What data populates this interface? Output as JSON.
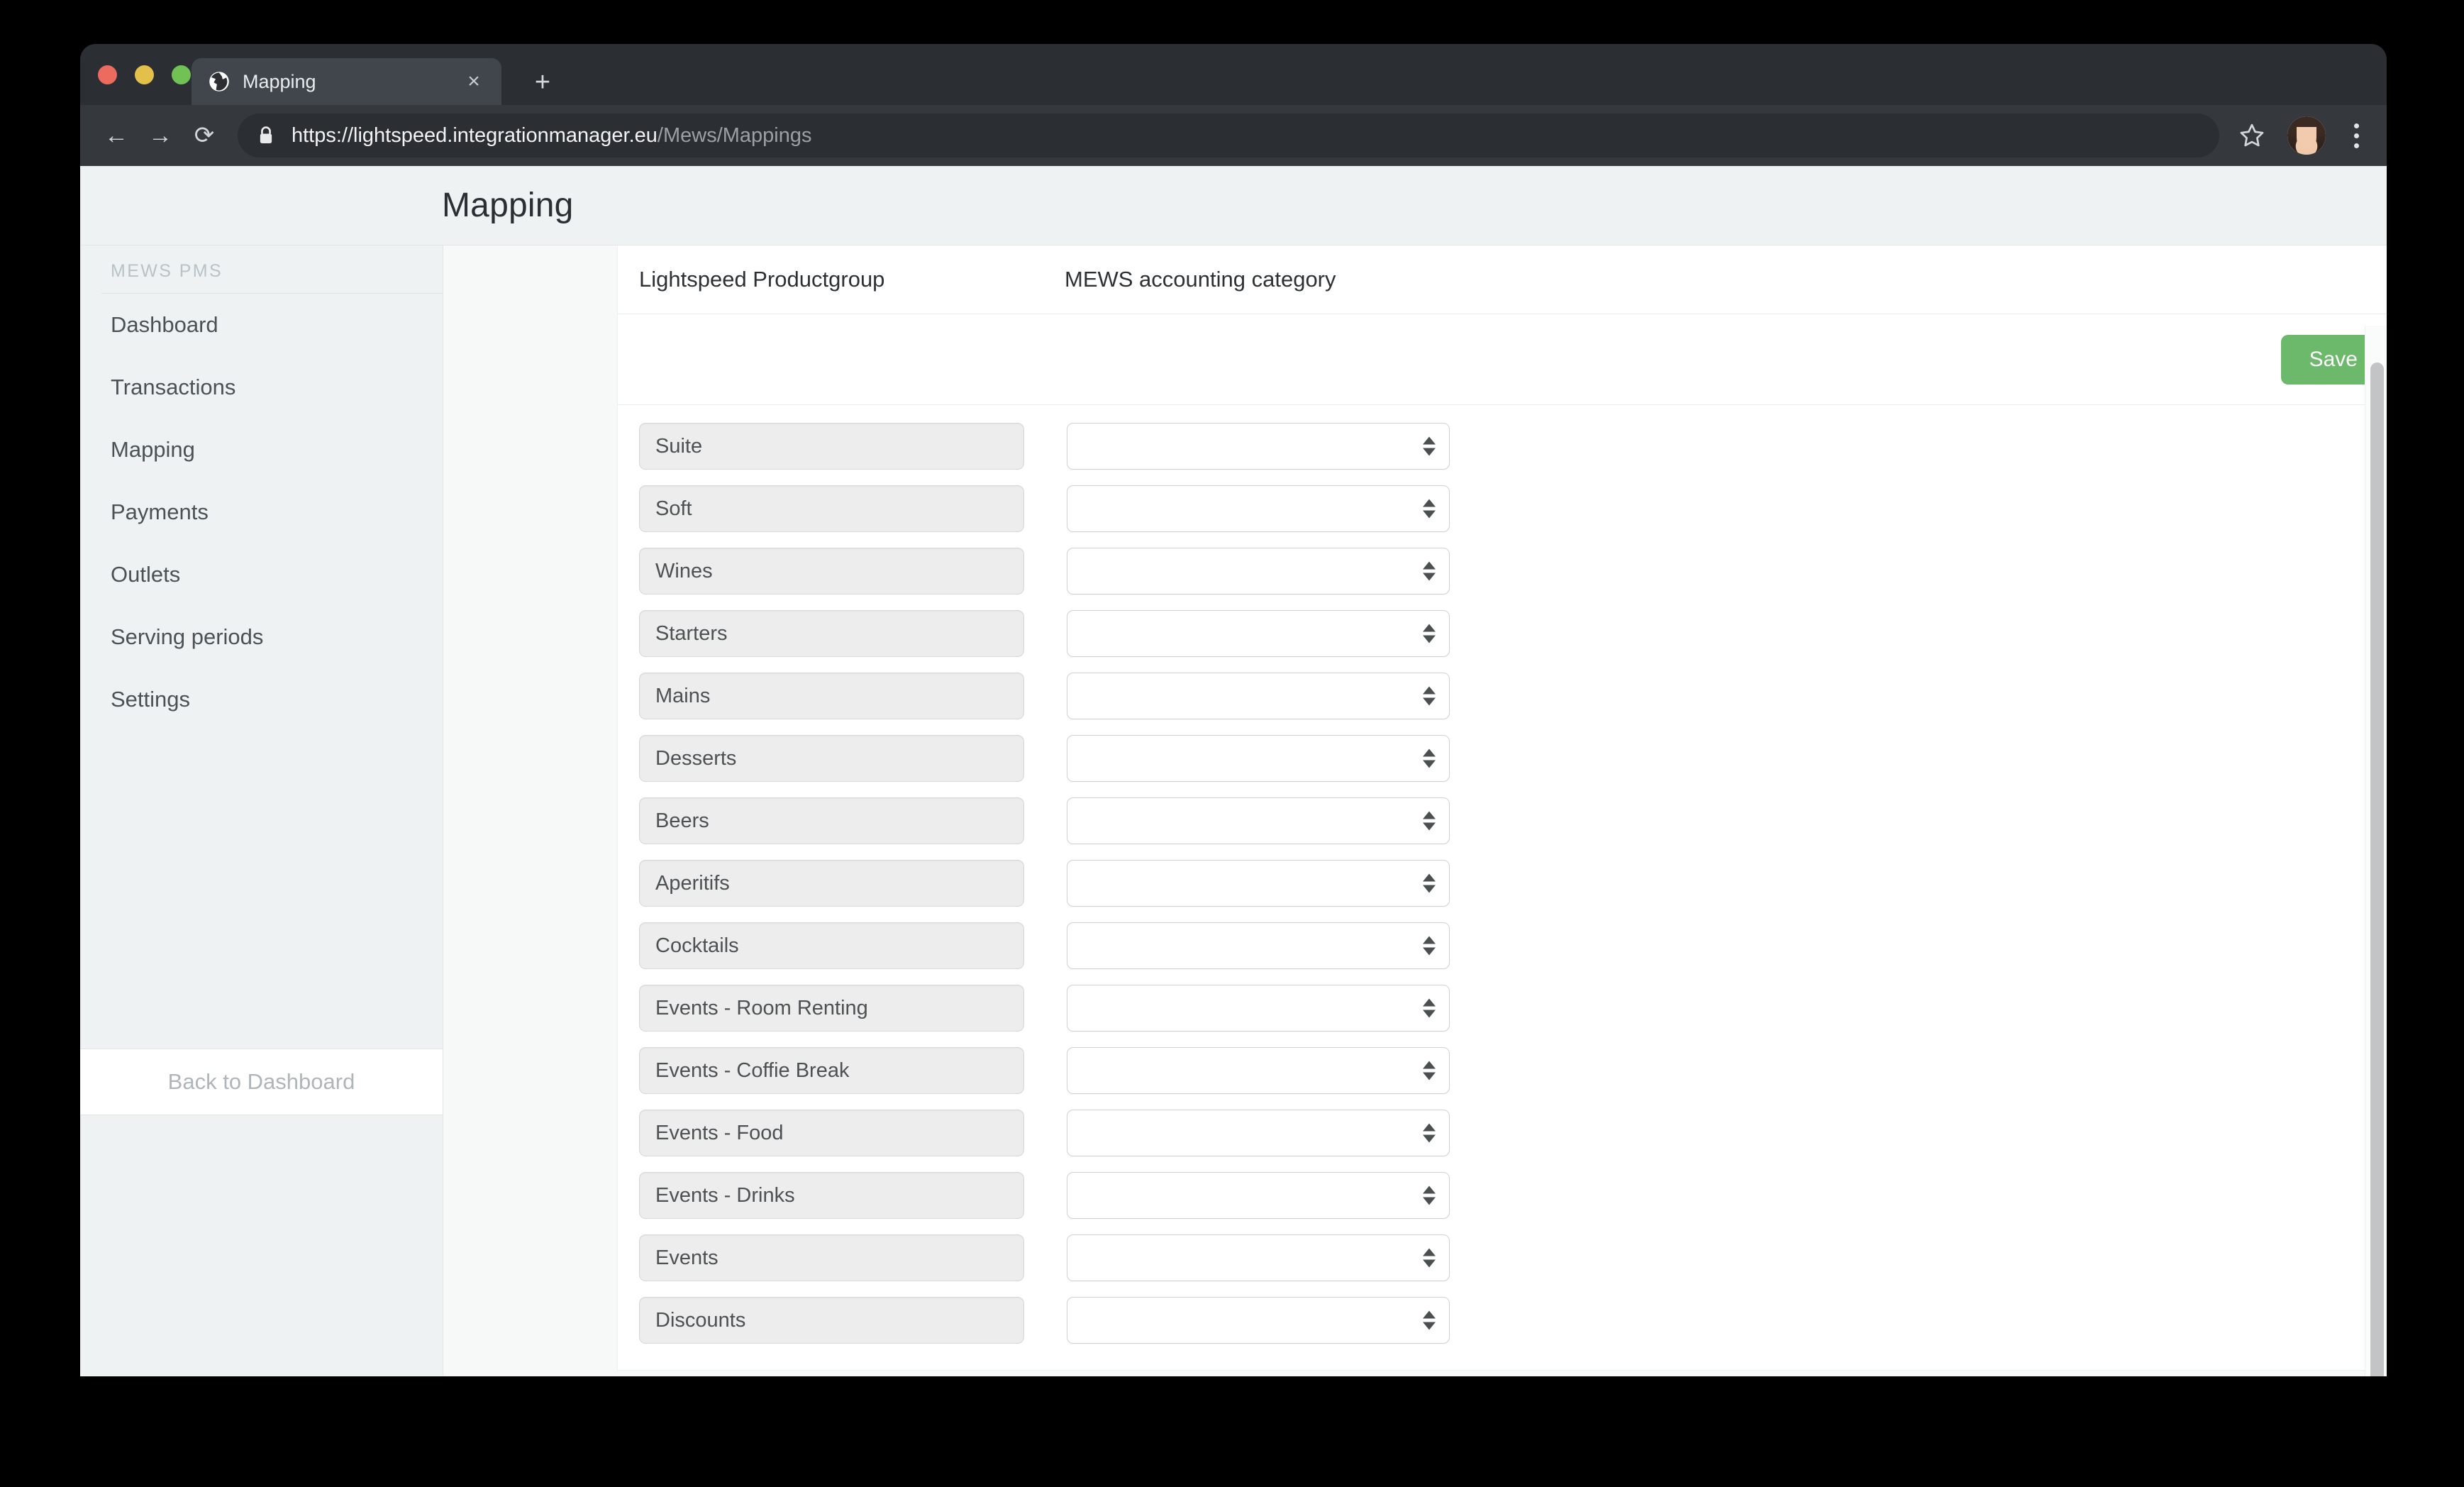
{
  "browser": {
    "tab": {
      "title": "Mapping",
      "favicon": "globe-icon",
      "close_label": "×"
    },
    "new_tab_label": "+",
    "toolbar": {
      "back_label": "←",
      "forward_label": "→",
      "reload_label": "⟳",
      "lock_icon": "lock-icon",
      "url_domain": "https://lightspeed.integrationmanager.eu",
      "url_path": "/Mews/Mappings",
      "bookmark_icon": "star-icon",
      "avatar_icon": "profile-avatar",
      "menu_icon": "three-dots-icon"
    }
  },
  "header": {
    "title": "Mapping"
  },
  "sidebar": {
    "heading": "MEWS PMS",
    "items": [
      {
        "label": "Dashboard"
      },
      {
        "label": "Transactions"
      },
      {
        "label": "Mapping"
      },
      {
        "label": "Payments"
      },
      {
        "label": "Outlets"
      },
      {
        "label": "Serving periods"
      },
      {
        "label": "Settings"
      }
    ],
    "footer_label": "Back to Dashboard"
  },
  "main": {
    "columns": {
      "productgroup": "Lightspeed Productgroup",
      "accounting_category": "MEWS accounting category"
    },
    "save_label": "Save",
    "save_color": "#6cb96c",
    "rows": [
      {
        "productgroup": "Suite",
        "category": ""
      },
      {
        "productgroup": "Soft",
        "category": ""
      },
      {
        "productgroup": "Wines",
        "category": ""
      },
      {
        "productgroup": "Starters",
        "category": ""
      },
      {
        "productgroup": "Mains",
        "category": ""
      },
      {
        "productgroup": "Desserts",
        "category": ""
      },
      {
        "productgroup": "Beers",
        "category": ""
      },
      {
        "productgroup": "Aperitifs",
        "category": ""
      },
      {
        "productgroup": "Cocktails",
        "category": ""
      },
      {
        "productgroup": "Events - Room Renting",
        "category": ""
      },
      {
        "productgroup": "Events - Coffie Break",
        "category": ""
      },
      {
        "productgroup": "Events - Food",
        "category": ""
      },
      {
        "productgroup": "Events - Drinks",
        "category": ""
      },
      {
        "productgroup": "Events",
        "category": ""
      },
      {
        "productgroup": "Discounts",
        "category": ""
      }
    ]
  }
}
